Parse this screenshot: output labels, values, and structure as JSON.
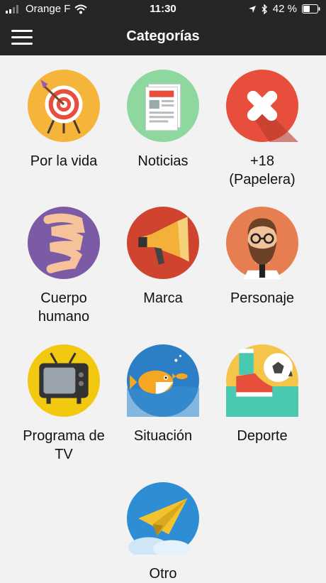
{
  "status_bar": {
    "carrier": "Orange F",
    "time": "11:30",
    "battery_percent": "42 %"
  },
  "nav": {
    "title": "Categorías",
    "menu_icon": "hamburger-icon"
  },
  "categories": [
    {
      "label": "Por la vida",
      "icon": "target-icon"
    },
    {
      "label": "Noticias",
      "icon": "newspaper-icon"
    },
    {
      "label": "+18\n(Papelera)",
      "icon": "x-mark-icon"
    },
    {
      "label": "Cuerpo\nhumano",
      "icon": "intestine-icon"
    },
    {
      "label": "Marca",
      "icon": "megaphone-icon"
    },
    {
      "label": "Personaje",
      "icon": "bearded-man-icon"
    },
    {
      "label": "Programa de\nTV",
      "icon": "tv-icon"
    },
    {
      "label": "Situación",
      "icon": "fish-icon"
    },
    {
      "label": "Deporte",
      "icon": "soccer-icon"
    },
    {
      "label": "Otro",
      "icon": "paper-plane-icon"
    }
  ]
}
